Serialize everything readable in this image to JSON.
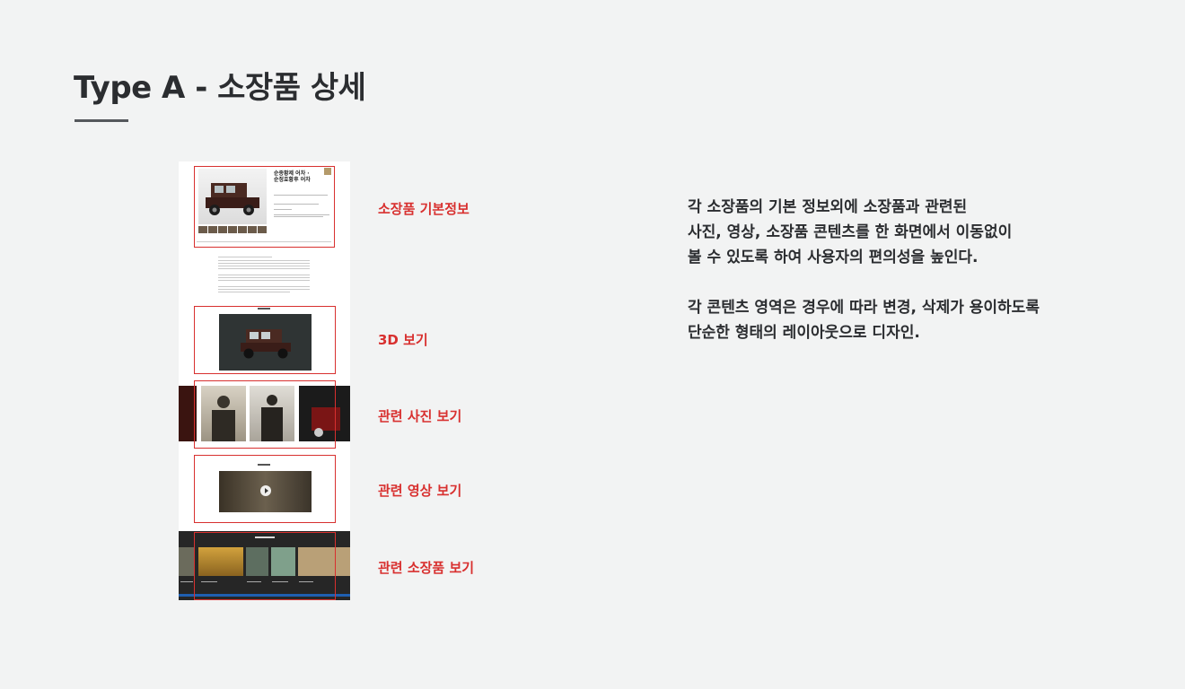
{
  "page": {
    "title": "Type A - 소장품 상세"
  },
  "mockup": {
    "object_title_line1": "순종황제 어차 ·",
    "object_title_line2": "순정효황후 어차"
  },
  "sections": [
    {
      "label": "소장품 기본정보"
    },
    {
      "label": "3D 보기"
    },
    {
      "label": "관련 사진 보기"
    },
    {
      "label": "관련 영상 보기"
    },
    {
      "label": "관련 소장품 보기"
    }
  ],
  "description": {
    "paragraph1": [
      "각 소장품의 기본 정보외에 소장품과 관련된",
      "사진, 영상, 소장품 콘텐츠를 한 화면에서 이동없이",
      "볼 수 있도록 하여 사용자의 편의성을 높인다."
    ],
    "paragraph2": [
      "각 콘텐츠 영역은 경우에 따라 변경, 삭제가 용이하도록",
      "단순한 형태의 레이아웃으로 디자인."
    ]
  },
  "colors": {
    "accent": "#d8302f",
    "title": "#2b2d30",
    "background": "#f2f3f3"
  }
}
